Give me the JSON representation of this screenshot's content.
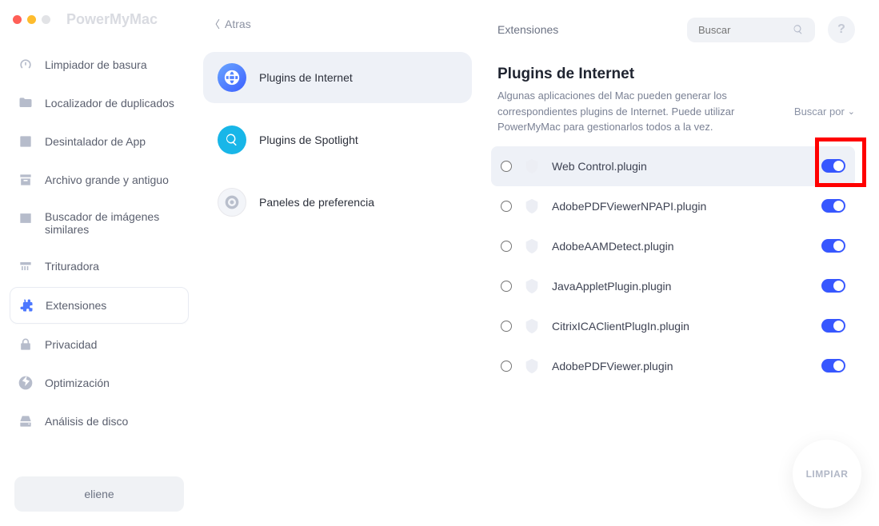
{
  "app_title": "PowerMyMac",
  "back_label": "Atras",
  "sidebar": {
    "items": [
      {
        "label": "Limpiador de basura"
      },
      {
        "label": "Localizador de duplicados"
      },
      {
        "label": "Desintalador de App"
      },
      {
        "label": "Archivo grande y antiguo"
      },
      {
        "label": "Buscador de imágenes similares"
      },
      {
        "label": "Trituradora"
      },
      {
        "label": "Extensiones"
      },
      {
        "label": "Privacidad"
      },
      {
        "label": "Optimización"
      },
      {
        "label": "Análisis de disco"
      }
    ],
    "user": "eliene"
  },
  "categories": [
    {
      "label": "Plugins de Internet"
    },
    {
      "label": "Plugins de Spotlight"
    },
    {
      "label": "Paneles de preferencia"
    }
  ],
  "header": {
    "section": "Extensiones",
    "search_placeholder": "Buscar",
    "help": "?"
  },
  "section": {
    "title": "Plugins de Internet",
    "desc": "Algunas aplicaciones del Mac pueden generar los correspondientes plugins de Internet. Puede utilizar PowerMyMac para gestionarlos todos a la vez.",
    "sort_label": "Buscar por"
  },
  "plugins": [
    {
      "name": "Web Control.plugin"
    },
    {
      "name": "AdobePDFViewerNPAPI.plugin"
    },
    {
      "name": "AdobeAAMDetect.plugin"
    },
    {
      "name": "JavaAppletPlugin.plugin"
    },
    {
      "name": "CitrixICAClientPlugIn.plugin"
    },
    {
      "name": "AdobePDFViewer.plugin"
    }
  ],
  "clean_button": "LIMPIAR"
}
